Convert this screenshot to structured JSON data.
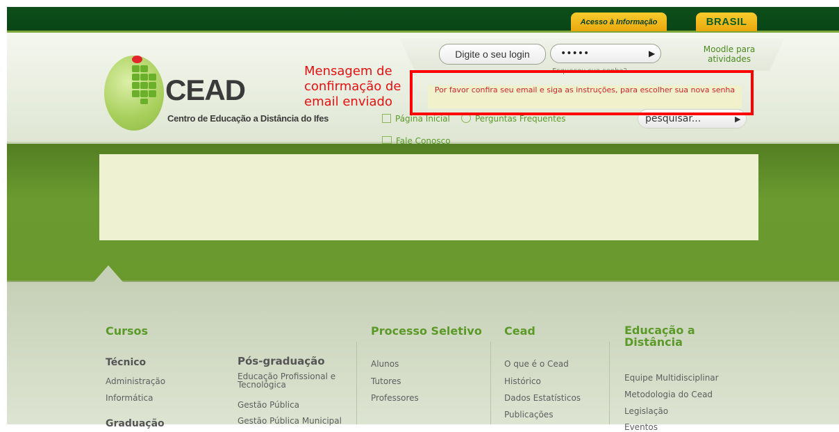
{
  "top_bar": {
    "acesso_label": "Acesso à Informação",
    "brasil_label": "BRASIL"
  },
  "logo": {
    "name": "CEAD",
    "subtitle": "Centro de Educação a Distância do Ifes"
  },
  "login": {
    "login_placeholder": "Digite o seu login",
    "password_value": "•••••",
    "moodle_link": "Moodle para atividades",
    "forgot_password": "Esqueceu sua senha?"
  },
  "message": "Por favor confira seu email e siga as instruções, para escolher sua nova senha",
  "annotation": "Mensagem de confirmação de email enviado",
  "nav": {
    "home": "Página Inicial",
    "faq": "Perguntas Frequentes",
    "contact": "Fale Conosco"
  },
  "search": {
    "placeholder": "pesquisar..."
  },
  "footer": {
    "cursos": {
      "title": "Cursos",
      "tecnico_title": "Técnico",
      "tecnico_items": [
        "Administração",
        "Informática"
      ],
      "graduacao_title": "Graduação",
      "pos_title": "Pós-graduação",
      "pos_items": [
        "Educação Profissional e Tecnológica",
        "Gestão Pública",
        "Gestão Pública Municipal"
      ]
    },
    "processo": {
      "title": "Processo Seletivo",
      "items": [
        "Alunos",
        "Tutores",
        "Professores"
      ]
    },
    "cead": {
      "title": "Cead",
      "items": [
        "O que é o Cead",
        "Histórico",
        "Dados Estatísticos",
        "Publicações"
      ]
    },
    "ead": {
      "title": "Educação a Distância",
      "items": [
        "Equipe Multidisciplinar",
        "Metodologia do Cead",
        "Legislação",
        "Eventos"
      ]
    }
  },
  "colors": {
    "dark_green": "#0d4f1b",
    "accent_green": "#6a9a30",
    "yellow_tab": "#f3bd1e",
    "message_red": "#d0242a",
    "annotation_red": "#ff0000"
  }
}
